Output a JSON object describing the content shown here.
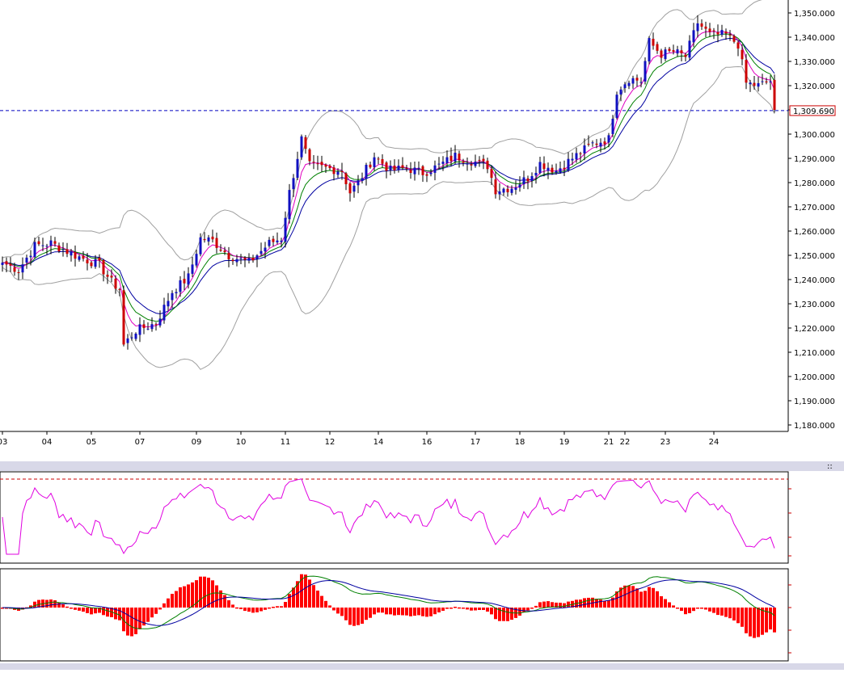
{
  "chart_data": {
    "type": "candlestick",
    "current_price_label": "1,309.690",
    "current_price": 1309.69,
    "y_ticks": [
      "1,350.000",
      "1,340.000",
      "1,330.000",
      "1,320.000",
      "1,310.000",
      "1,300.000",
      "1,290.000",
      "1,280.000",
      "1,270.000",
      "1,260.000",
      "1,250.000",
      "1,240.000",
      "1,230.000",
      "1,220.000",
      "1,210.000",
      "1,200.000",
      "1,190.000",
      "1,180.000"
    ],
    "y_tick_values": [
      1350,
      1340,
      1330,
      1320,
      1310,
      1300,
      1290,
      1280,
      1270,
      1260,
      1250,
      1240,
      1230,
      1220,
      1210,
      1200,
      1190,
      1180
    ],
    "ylim": [
      1177,
      1355
    ],
    "x_labels": [
      "03",
      "04",
      "05",
      "07",
      "09",
      "10",
      "11",
      "12",
      "14",
      "16",
      "17",
      "18",
      "19",
      "21",
      "22",
      "23",
      "24"
    ],
    "x_label_index": [
      0,
      11,
      22,
      34,
      48,
      59,
      70,
      81,
      93,
      105,
      117,
      128,
      139,
      150,
      154,
      164,
      176
    ],
    "n_bars": 192,
    "waypoints": [
      [
        0,
        1247
      ],
      [
        4,
        1244
      ],
      [
        8,
        1254
      ],
      [
        12,
        1255
      ],
      [
        18,
        1250
      ],
      [
        24,
        1246
      ],
      [
        27,
        1239
      ],
      [
        29,
        1236
      ],
      [
        30,
        1213
      ],
      [
        33,
        1219
      ],
      [
        38,
        1222
      ],
      [
        42,
        1235
      ],
      [
        46,
        1241
      ],
      [
        49,
        1257
      ],
      [
        52,
        1256
      ],
      [
        56,
        1250
      ],
      [
        61,
        1247
      ],
      [
        66,
        1255
      ],
      [
        69,
        1257
      ],
      [
        71,
        1276
      ],
      [
        74,
        1298
      ],
      [
        76,
        1287
      ],
      [
        80,
        1286
      ],
      [
        84,
        1285
      ],
      [
        86,
        1276
      ],
      [
        88,
        1280
      ],
      [
        92,
        1291
      ],
      [
        96,
        1285
      ],
      [
        100,
        1286
      ],
      [
        104,
        1284
      ],
      [
        108,
        1287
      ],
      [
        112,
        1291
      ],
      [
        116,
        1289
      ],
      [
        120,
        1287
      ],
      [
        122,
        1277
      ],
      [
        126,
        1278
      ],
      [
        130,
        1282
      ],
      [
        133,
        1288
      ],
      [
        137,
        1285
      ],
      [
        141,
        1290
      ],
      [
        146,
        1296
      ],
      [
        150,
        1298
      ],
      [
        152,
        1318
      ],
      [
        155,
        1323
      ],
      [
        158,
        1322
      ],
      [
        160,
        1338
      ],
      [
        163,
        1333
      ],
      [
        166,
        1334
      ],
      [
        169,
        1332
      ],
      [
        172,
        1346
      ],
      [
        175,
        1341
      ],
      [
        179,
        1341
      ],
      [
        182,
        1337
      ],
      [
        184,
        1321
      ],
      [
        187,
        1320
      ],
      [
        190,
        1322
      ],
      [
        191,
        1310
      ]
    ],
    "overlays": [
      "upper-band",
      "lower-band",
      "ma-short",
      "ma-mid",
      "ma-long"
    ],
    "colors": {
      "up": "#1010c0",
      "down": "#cc0000",
      "upper_band": "#a0a0a0",
      "ma_short": "#e000c0",
      "ma_mid": "#008000",
      "ma_long": "#0000a0",
      "indicator_line": "#e000e0",
      "price_line": "#0000c0",
      "macd_hist": "#ff0000"
    },
    "indicator_panels": [
      "oscillator",
      "macd"
    ]
  }
}
